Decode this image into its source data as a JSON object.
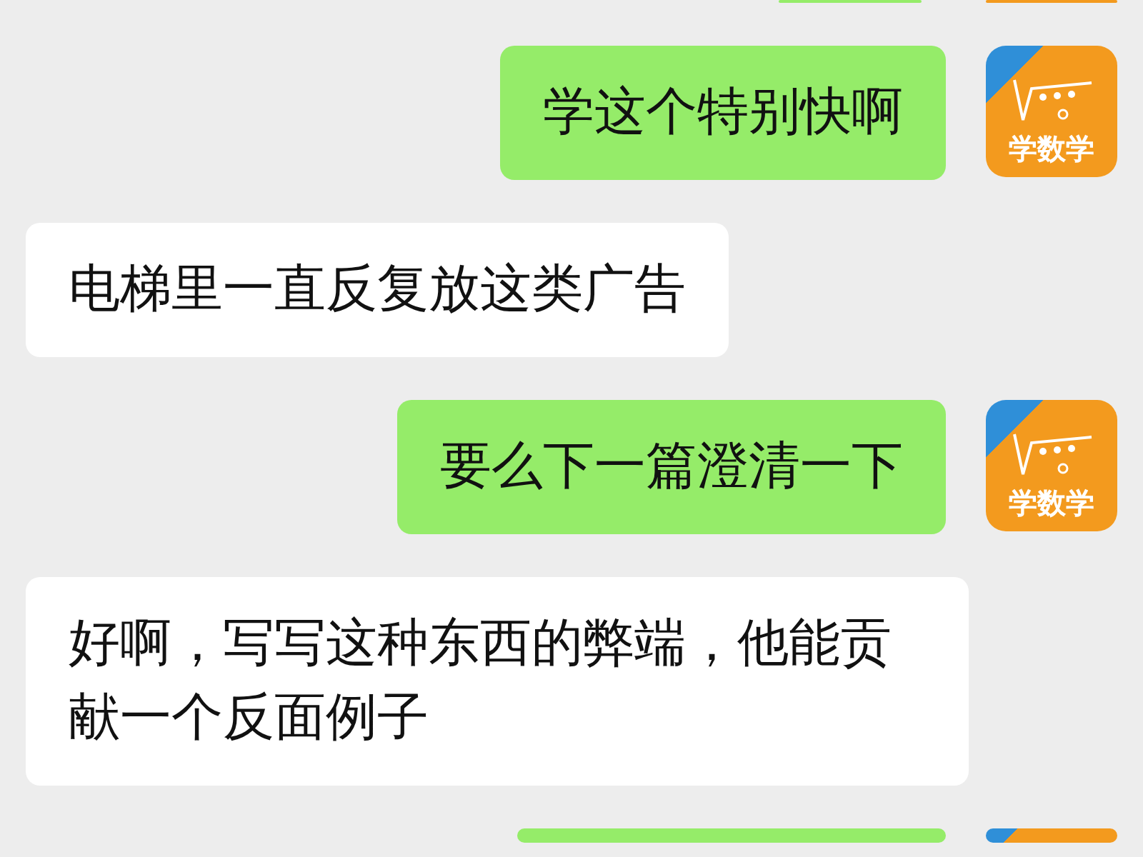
{
  "messages": [
    {
      "kind": "cut-off",
      "outgoing": true
    },
    {
      "kind": "text",
      "outgoing": true,
      "text": "学这个特别快啊",
      "avatar": {
        "label": "学数学"
      }
    },
    {
      "kind": "text",
      "outgoing": false,
      "text": "电梯里一直反复放这类广告"
    },
    {
      "kind": "text",
      "outgoing": true,
      "text": "要么下一篇澄清一下",
      "avatar": {
        "label": "学数学"
      }
    },
    {
      "kind": "text",
      "outgoing": false,
      "text": "好啊，写写这种东西的弊端，他能贡献一个反面例子"
    },
    {
      "kind": "cut-off",
      "outgoing": true
    }
  ]
}
